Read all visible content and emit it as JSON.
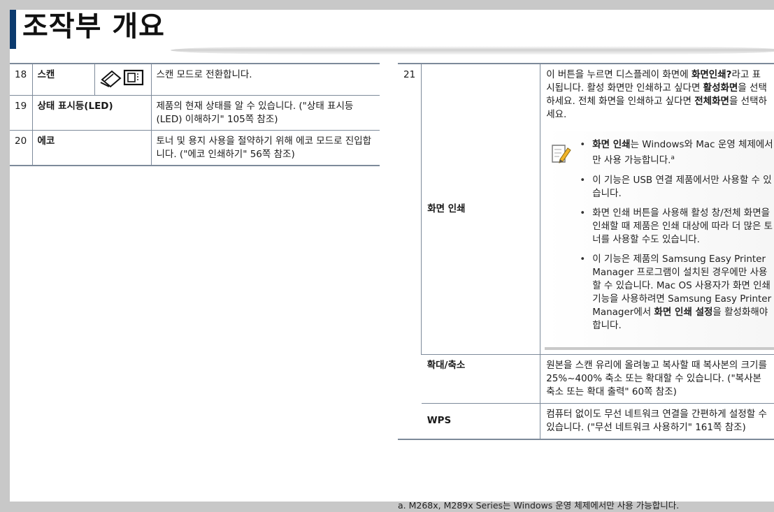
{
  "title": "조작부 개요",
  "left_table": {
    "rows": [
      {
        "num": "18",
        "name": "스캔",
        "desc": "스캔 모드로 전환합니다."
      },
      {
        "num": "19",
        "name": "상태 표시등(LED)",
        "desc": "제품의 현재 상태를 알 수 있습니다. (\"상태 표시등(LED) 이해하기\" 105쪽 참조)"
      },
      {
        "num": "20",
        "name": "에코",
        "desc": "토너 및 용지 사용을 절약하기 위해 에코 모드로 진입합니다. (\"에코 인쇄하기\" 56쪽 참조)"
      }
    ]
  },
  "right_table": {
    "num": "21",
    "print_screen": {
      "name": "화면 인쇄",
      "desc_parts": {
        "p1": "이 버튼을 누르면 디스플레이 화면에 ",
        "b1": "화면인쇄?",
        "p2": "라고 표시됩니다. 활성 화면만 인쇄하고 싶다면 ",
        "b2": "활성화면",
        "p3": "을 선택하세요. 전체 화면을 인쇄하고 싶다면 ",
        "b3": "전체화면",
        "p4": "을 선택하세요."
      },
      "notes": {
        "n1_bold": "화면 인쇄",
        "n1_text": "는 Windows와 Mac 운영 체제에서만 사용 가능합니다.",
        "n1_sup": "a",
        "n2": "이 기능은 USB 연결 제품에서만 사용할 수 있습니다.",
        "n3": "화면 인쇄 버튼을 사용해 활성 창/전체 화면을 인쇄할 때 제품은 인쇄 대상에 따라 더 많은 토너를 사용할 수도 있습니다.",
        "n4_text": "이 기능은 제품의 Samsung Easy Printer Manager 프로그램이 설치된 경우에만 사용할 수 있습니다. Mac OS 사용자가 화면 인쇄 기능을 사용하려면 Samsung Easy Printer Manager에서 ",
        "n4_bold": "화면 인쇄 설정",
        "n4_end": "을 활성화해야 합니다."
      }
    },
    "zoom": {
      "name": "확대/축소",
      "desc": "원본을 스캔 유리에 올려놓고 복사할 때 복사본의 크기를 25%~400% 축소 또는 확대할 수 있습니다. (\"복사본 축소 또는 확대 출력\" 60쪽 참조)"
    },
    "wps": {
      "name": "WPS",
      "desc": "컴퓨터 없이도 무선 네트워크 연결을 간편하게 설정할 수 있습니다. (\"무선 네트워크 사용하기\" 161쪽 참조)"
    }
  },
  "footnote": "a.  M268x, M289x Series는 Windows 운영 체제에서만 사용 가능합니다.",
  "colors": {
    "accent": "#0b3a6e",
    "rule": "#7d8a9a"
  },
  "icons": [
    "scanner-icon",
    "scan-screen-icon",
    "note-pencil-icon"
  ]
}
